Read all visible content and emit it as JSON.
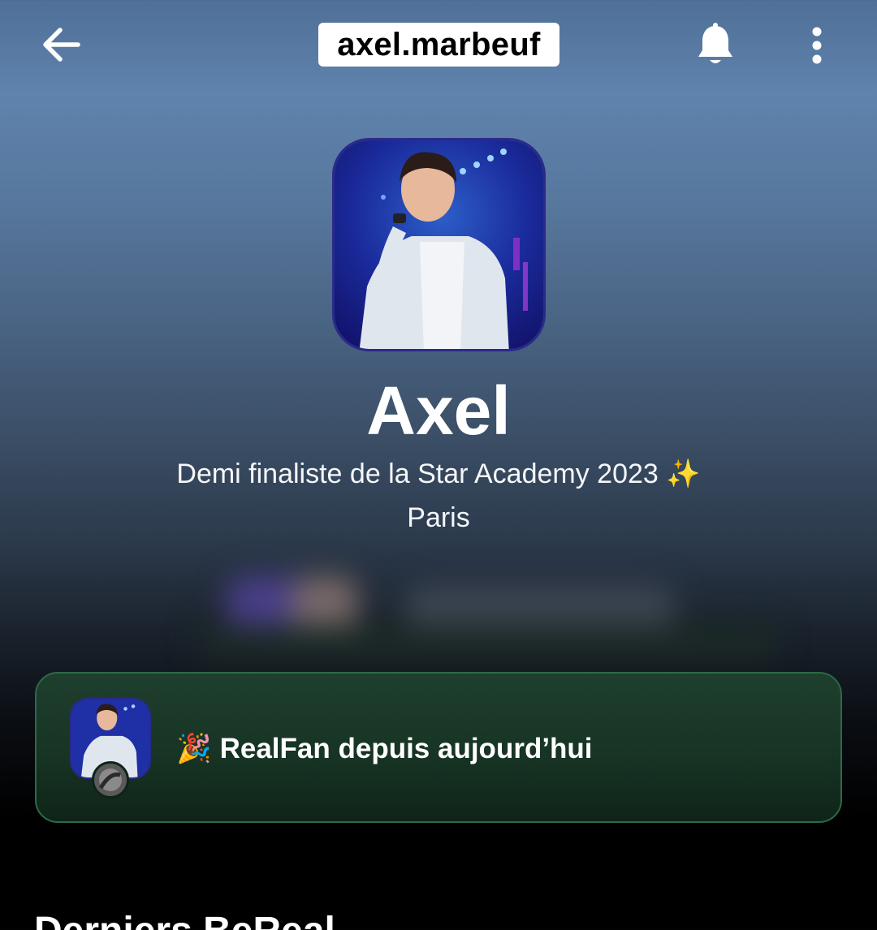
{
  "header": {
    "username": "axel.marbeuf",
    "back_icon": "arrow-left-icon",
    "notification_icon": "bell-icon",
    "menu_icon": "more-vertical-icon"
  },
  "profile": {
    "display_name": "Axel",
    "bio": "Demi finaliste de la Star Academy 2023 ✨",
    "location": "Paris"
  },
  "realfan_card": {
    "emoji": "🎉",
    "text": "RealFan depuis aujourd’hui",
    "accent": "#1f3f2e",
    "border": "#2a6b44"
  },
  "sections": {
    "latest_title": "Derniers BeReal"
  }
}
